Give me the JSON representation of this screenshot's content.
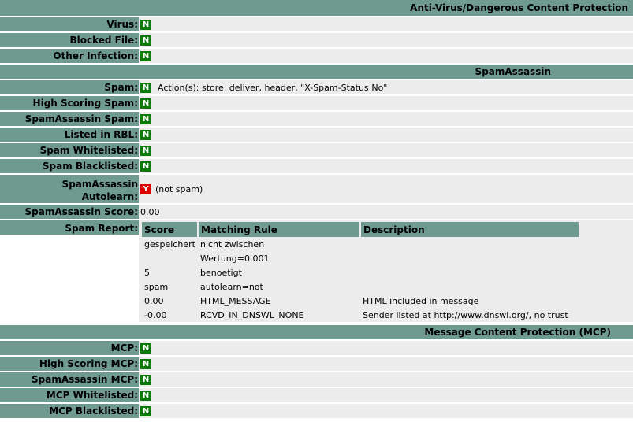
{
  "sections": {
    "antivirus": "Anti-Virus/Dangerous Content Protection",
    "spamassassin": "SpamAssassin",
    "mcp": "Message Content Protection (MCP)"
  },
  "antivirus_rows": [
    {
      "label": "Virus:",
      "badge": "N"
    },
    {
      "label": "Blocked File:",
      "badge": "N"
    },
    {
      "label": "Other Infection:",
      "badge": "N"
    }
  ],
  "spam_rows": {
    "spam": {
      "label": "Spam:",
      "badge": "N",
      "note": "Action(s): store, deliver, header, \"X-Spam-Status:No\""
    },
    "high_scoring": {
      "label": "High Scoring Spam:",
      "badge": "N"
    },
    "sa_spam": {
      "label": "SpamAssassin Spam:",
      "badge": "N"
    },
    "rbl": {
      "label": "Listed in RBL:",
      "badge": "N"
    },
    "whitelisted": {
      "label": "Spam Whitelisted:",
      "badge": "N"
    },
    "blacklisted": {
      "label": "Spam Blacklisted:",
      "badge": "N"
    },
    "autolearn": {
      "label_line1": "SpamAssassin",
      "label_line2": "Autolearn:",
      "badge": "Y",
      "note": "(not spam)"
    },
    "score": {
      "label": "SpamAssassin Score:",
      "value": "0.00"
    },
    "report_label": "Spam Report:"
  },
  "report": {
    "headers": [
      "Score",
      "Matching Rule",
      "Description"
    ],
    "rows": [
      [
        "gespeichert",
        "nicht zwischen",
        ""
      ],
      [
        "",
        "Wertung=0.001",
        ""
      ],
      [
        "5",
        "benoetigt",
        ""
      ],
      [
        "spam",
        "autolearn=not",
        ""
      ],
      [
        "0.00",
        "HTML_MESSAGE",
        "HTML included in message"
      ],
      [
        "-0.00",
        "RCVD_IN_DNSWL_NONE",
        "Sender listed at http://www.dnswl.org/, no trust"
      ]
    ]
  },
  "mcp_rows": [
    {
      "label": "MCP:",
      "badge": "N"
    },
    {
      "label": "High Scoring MCP:",
      "badge": "N"
    },
    {
      "label": "SpamAssassin MCP:",
      "badge": "N"
    },
    {
      "label": "MCP Whitelisted:",
      "badge": "N"
    },
    {
      "label": "MCP Blacklisted:",
      "badge": "N"
    }
  ],
  "colors": {
    "header_bg": "#6f9a8f",
    "value_bg": "#ececec",
    "no_badge": "#0b7a0b",
    "yes_badge": "#d90000"
  }
}
